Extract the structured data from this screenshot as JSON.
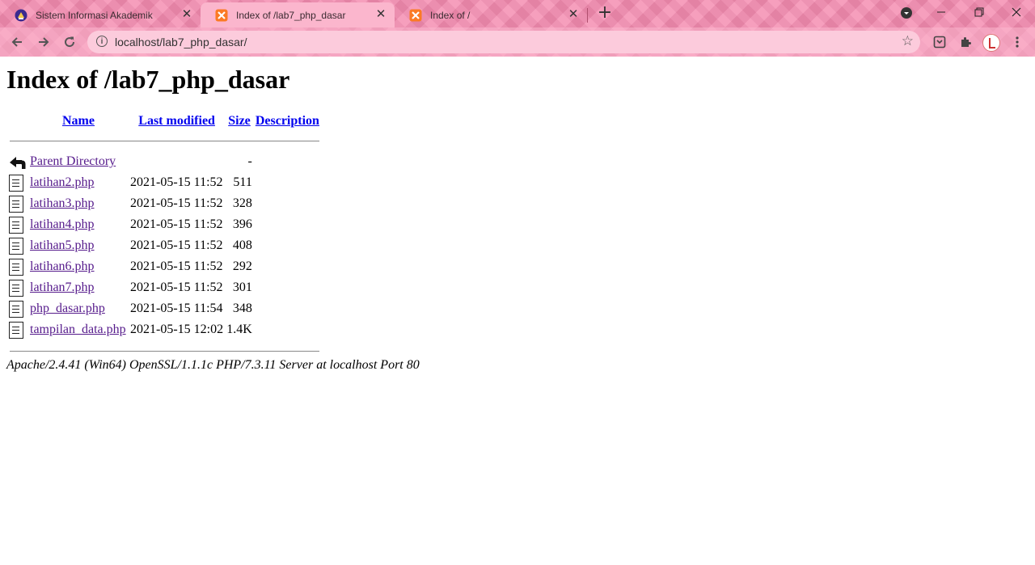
{
  "browser": {
    "tabs": [
      {
        "title": "Sistem Informasi Akademik",
        "active": false,
        "favicon": "university-icon"
      },
      {
        "title": "Index of /lab7_php_dasar",
        "active": true,
        "favicon": "xampp-icon"
      },
      {
        "title": "Index of /",
        "active": false,
        "favicon": "xampp-icon"
      }
    ],
    "new_tab": "+",
    "url": "localhost/lab7_php_dasar/",
    "colors": {
      "chrome": "#f48bb0",
      "active_tab": "#fbb6cd",
      "omnibox": "#fccbdc"
    }
  },
  "page": {
    "title": "Index of /lab7_php_dasar",
    "columns": {
      "name": "Name",
      "modified": "Last modified",
      "size": "Size",
      "description": "Description"
    },
    "parent": {
      "name": "Parent Directory",
      "size": "-"
    },
    "files": [
      {
        "name": "latihan2.php",
        "modified": "2021-05-15 11:52",
        "size": "511"
      },
      {
        "name": "latihan3.php",
        "modified": "2021-05-15 11:52",
        "size": "328"
      },
      {
        "name": "latihan4.php",
        "modified": "2021-05-15 11:52",
        "size": "396"
      },
      {
        "name": "latihan5.php",
        "modified": "2021-05-15 11:52",
        "size": "408"
      },
      {
        "name": "latihan6.php",
        "modified": "2021-05-15 11:52",
        "size": "292"
      },
      {
        "name": "latihan7.php",
        "modified": "2021-05-15 11:52",
        "size": "301"
      },
      {
        "name": "php_dasar.php",
        "modified": "2021-05-15 11:54",
        "size": "348"
      },
      {
        "name": "tampilan_data.php",
        "modified": "2021-05-15 12:02",
        "size": "1.4K"
      }
    ],
    "footer": "Apache/2.4.41 (Win64) OpenSSL/1.1.1c PHP/7.3.11 Server at localhost Port 80"
  }
}
